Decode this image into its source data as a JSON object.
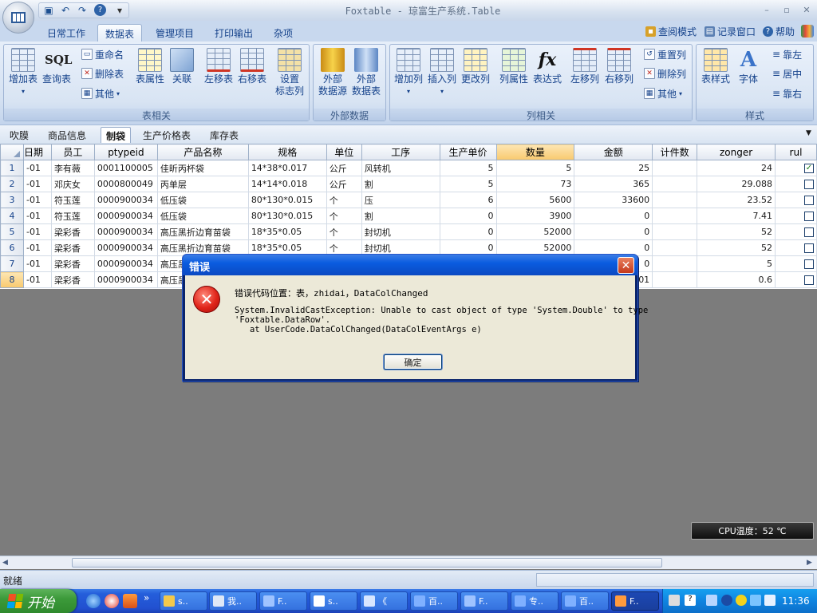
{
  "window": {
    "title": "Foxtable - 琼富生产系统.Table",
    "controls": [
      "–",
      "▫",
      "✕"
    ]
  },
  "ribbon_tabs": [
    "日常工作",
    "数据表",
    "管理项目",
    "打印输出",
    "杂项"
  ],
  "ribbon_links": [
    {
      "label": "查阅模式",
      "icon": "lock-icon"
    },
    {
      "label": "记录窗口",
      "icon": "window-icon"
    },
    {
      "label": "帮助",
      "icon": "help-icon"
    }
  ],
  "groups": [
    {
      "label": "表相关"
    },
    {
      "label": "外部数据"
    },
    {
      "label": "列相关"
    },
    {
      "label": "样式"
    }
  ],
  "buttons": {
    "add_table": "增加表",
    "query_table": "查询表",
    "rename": "重命名",
    "delete_table": "删除表",
    "other": "其他",
    "table_props": "表属性",
    "relation": "关联",
    "move_left": "左移表",
    "move_right": "右移表",
    "set_label_col": "设置\n标志列",
    "ext_source": "外部\n数据源",
    "ext_table": "外部\n数据表",
    "add_col": "增加列",
    "insert_col": "插入列",
    "modify_col": "更改列",
    "col_props": "列属性",
    "expression": "表达式",
    "col_left": "左移列",
    "col_right": "右移列",
    "reset_col": "重置列",
    "delete_col": "删除列",
    "other_col": "其他",
    "table_style": "表样式",
    "font": "字体",
    "align_left": "靠左",
    "align_center": "居中",
    "align_right": "靠右",
    "sql_text": "SQL",
    "fx_text": "fx"
  },
  "sheet_tabs": [
    "吹膜",
    "商品信息",
    "制袋",
    "生产价格表",
    "库存表"
  ],
  "active_sheet": 2,
  "grid": {
    "columns": [
      "日期",
      "员工",
      "ptypeid",
      "产品名称",
      "规格",
      "单位",
      "工序",
      "生产单价",
      "数量",
      "金额",
      "计件数",
      "zonger",
      "rul"
    ],
    "rows": [
      {
        "n": "1",
        "c": [
          "-01",
          "李有薇",
          "0001100005",
          "佳昕丙杯袋",
          "14*38*0.017",
          "公斤",
          "风转机",
          "5",
          "5",
          "25",
          "",
          "24"
        ],
        "checked": true
      },
      {
        "n": "2",
        "c": [
          "-01",
          "邓庆女",
          "0000800049",
          "丙单层",
          "14*14*0.018",
          "公斤",
          "割",
          "5",
          "73",
          "365",
          "",
          "29.088"
        ],
        "checked": false
      },
      {
        "n": "3",
        "c": [
          "-01",
          "符玉莲",
          "0000900034",
          "低压袋",
          "80*130*0.015",
          "个",
          "压",
          "6",
          "5600",
          "33600",
          "",
          "23.52"
        ],
        "checked": false
      },
      {
        "n": "4",
        "c": [
          "-01",
          "符玉莲",
          "0000900034",
          "低压袋",
          "80*130*0.015",
          "个",
          "割",
          "0",
          "3900",
          "0",
          "",
          "7.41"
        ],
        "checked": false
      },
      {
        "n": "5",
        "c": [
          "-01",
          "梁彩香",
          "0000900034",
          "高压黑折边育苗袋",
          "18*35*0.05",
          "个",
          "封切机",
          "0",
          "52000",
          "0",
          "",
          "52"
        ],
        "checked": false
      },
      {
        "n": "6",
        "c": [
          "-01",
          "梁彩香",
          "0000900034",
          "高压黑折边育苗袋",
          "18*35*0.05",
          "个",
          "封切机",
          "0",
          "52000",
          "0",
          "",
          "52"
        ],
        "checked": false
      },
      {
        "n": "7",
        "c": [
          "-01",
          "梁彩香",
          "0000900034",
          "高压黑",
          "",
          "",
          "",
          "",
          "",
          "0",
          "",
          "5"
        ],
        "checked": false
      },
      {
        "n": "8",
        "c": [
          "-01",
          "梁彩香",
          "0000900034",
          "高压黑",
          "",
          "",
          "",
          "",
          "",
          "01",
          "",
          "0.6"
        ],
        "checked": false
      }
    ]
  },
  "dialog": {
    "title": "错误",
    "line1": "错误代码位置：表，zhidai，DataColChanged",
    "line2": "System.InvalidCastException: Unable to cast object of type 'System.Double' to type",
    "line3": "'Foxtable.DataRow'.",
    "line4": "   at UserCode.DataColChanged(DataColEventArgs e)",
    "ok": "确定",
    "close": "✕",
    "icon_glyph": "✕"
  },
  "cpu_badge": "CPU温度：52 ℃",
  "status": "就绪",
  "taskbar": {
    "start": "开始",
    "more": "»",
    "items": [
      {
        "label": "s..",
        "icon": "folder-icon",
        "color": "#f3c94b"
      },
      {
        "label": "我..",
        "icon": "chat-icon",
        "color": "#dfe8f6"
      },
      {
        "label": "F..",
        "icon": "app-icon",
        "color": "#9fc3ff"
      },
      {
        "label": "s..",
        "icon": "doc-icon",
        "color": "#ffffff"
      },
      {
        "label": "《",
        "icon": "table-icon",
        "color": "#d8e7ff"
      },
      {
        "label": "百..",
        "icon": "ie-icon",
        "color": "#7fb0ff"
      },
      {
        "label": "F..",
        "icon": "app-icon",
        "color": "#9fc3ff"
      },
      {
        "label": "专..",
        "icon": "ie-icon",
        "color": "#7fb0ff"
      },
      {
        "label": "百..",
        "icon": "ie-icon",
        "color": "#7fb0ff"
      },
      {
        "label": "F..",
        "icon": "foxtable-icon",
        "color": "#ff9b3d"
      }
    ],
    "clock": "11:36"
  }
}
